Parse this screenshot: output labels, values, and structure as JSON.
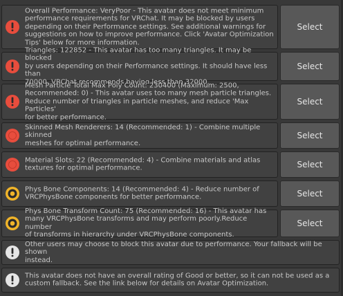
{
  "colors": {
    "error": "#e84d3d",
    "warning": "#f0b429",
    "info": "#e6e6e6"
  },
  "messages": [
    {
      "icon": "error-icon",
      "text": "Overall Performance: VeryPoor - This avatar does not meet minimum\nperformance requirements for VRChat. It may be blocked by users\ndepending on their Performance settings. See additional warnings for\nsuggestions on how to improve performance. Click 'Avatar Optimization\nTips' below for more information.",
      "button": "Select"
    },
    {
      "icon": "error-icon",
      "text": "Triangles: 122852 - This avatar has too many triangles. It may be blocked\nby users depending on their Performance settings. It should have less than\n70000. VRChat recommends having less than 32000.",
      "button": "Select"
    },
    {
      "icon": "error-icon",
      "text": "Mesh Particle Total Max Poly Count: 230400 (Maximum: 2500,\nRecommended: 0) - This avatar uses too many mesh particle triangles.\nReduce number of triangles in particle meshes, and reduce 'Max Particles'\nfor better performance.",
      "button": "Select"
    },
    {
      "icon": "error-dot-icon",
      "text": "Skinned Mesh Renderers: 14 (Recommended: 1) - Combine multiple skinned\nmeshes for optimal performance.",
      "button": "Select"
    },
    {
      "icon": "error-dot-icon",
      "text": "Material Slots: 22 (Recommended: 4) - Combine materials and atlas\ntextures for optimal performance.",
      "button": "Select"
    },
    {
      "icon": "warning-dot-icon",
      "text": "Phys Bone Components: 14 (Recommended: 4) - Reduce number of\nVRCPhysBone components for better performance.",
      "button": "Select"
    },
    {
      "icon": "warning-dot-icon",
      "text": "Phys Bone Transform Count: 75 (Recommended: 16) - This avatar has\nmany VRCPhysBone transforms and may perform poorly.Reduce number\nof transforms in hierarchy under VRCPhysBone components.",
      "button": "Select"
    },
    {
      "icon": "info-icon",
      "text": "Other users may choose to block this avatar due to performance. Your fallback will be shown\ninstead."
    },
    {
      "icon": "info-icon",
      "text": "This avatar does not have an overall rating of Good or better, so it can not be used as a\ncustom fallback. See the link below for details on Avatar Optimization."
    }
  ]
}
